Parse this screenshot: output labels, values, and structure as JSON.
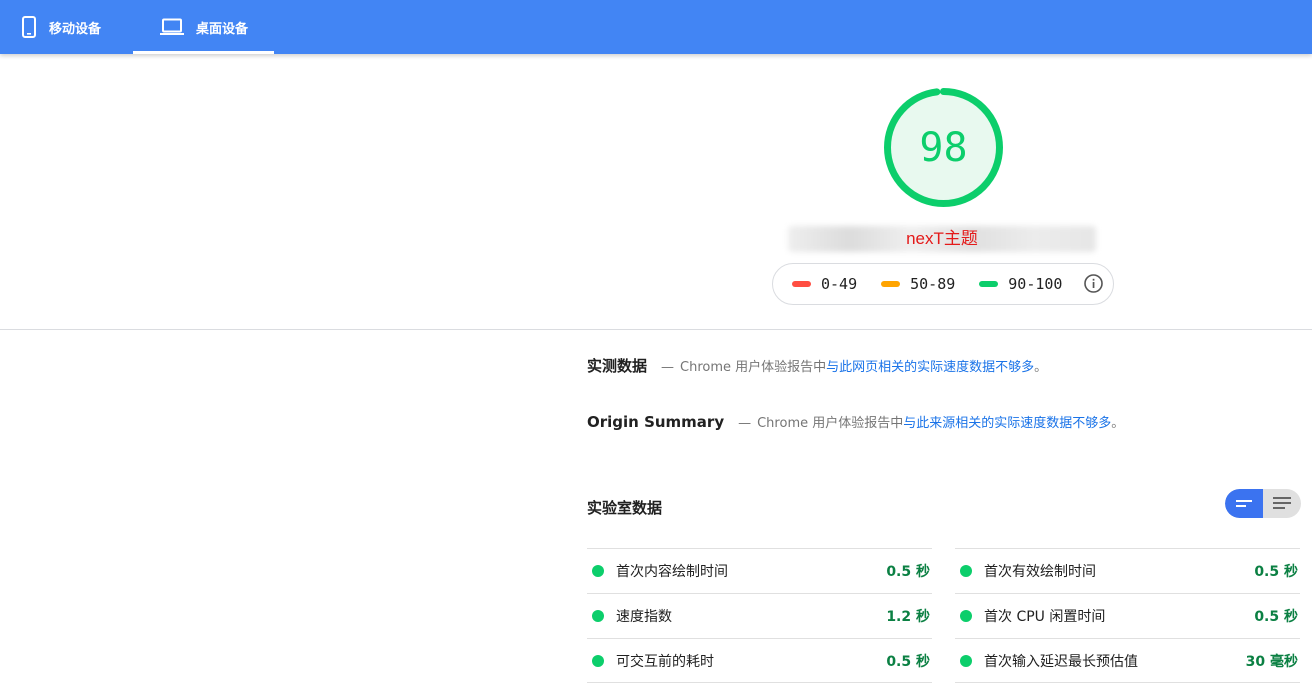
{
  "tabs": [
    {
      "label": "移动设备",
      "icon": "phone-icon",
      "active": false
    },
    {
      "label": "桌面设备",
      "icon": "laptop-icon",
      "active": true
    }
  ],
  "score": {
    "value": "98",
    "fraction": 0.98,
    "color": "#0cce6b"
  },
  "url": {
    "label": "nexT主题"
  },
  "legend": [
    {
      "range": "0-49",
      "color": "#ff4e42"
    },
    {
      "range": "50-89",
      "color": "#ffa400"
    },
    {
      "range": "90-100",
      "color": "#0cce6b"
    }
  ],
  "field_data": {
    "title": "实测数据",
    "dash": "—",
    "prefix": "Chrome 用户体验报告中",
    "link": "与此网页相关的实际速度数据不够多",
    "suffix": "。"
  },
  "origin_summary": {
    "title": "Origin Summary",
    "dash": "—",
    "prefix": "Chrome 用户体验报告中",
    "link": "与此来源相关的实际速度数据不够多",
    "suffix": "。"
  },
  "lab_data": {
    "title": "实验室数据",
    "metrics_left": [
      {
        "label": "首次内容绘制时间",
        "value": "0.5 秒"
      },
      {
        "label": "速度指数",
        "value": "1.2 秒"
      },
      {
        "label": "可交互前的耗时",
        "value": "0.5 秒"
      }
    ],
    "metrics_right": [
      {
        "label": "首次有效绘制时间",
        "value": "0.5 秒"
      },
      {
        "label": "首次 CPU 闲置时间",
        "value": "0.5 秒"
      },
      {
        "label": "首次输入延迟最长预估值",
        "value": "30 毫秒"
      }
    ]
  }
}
